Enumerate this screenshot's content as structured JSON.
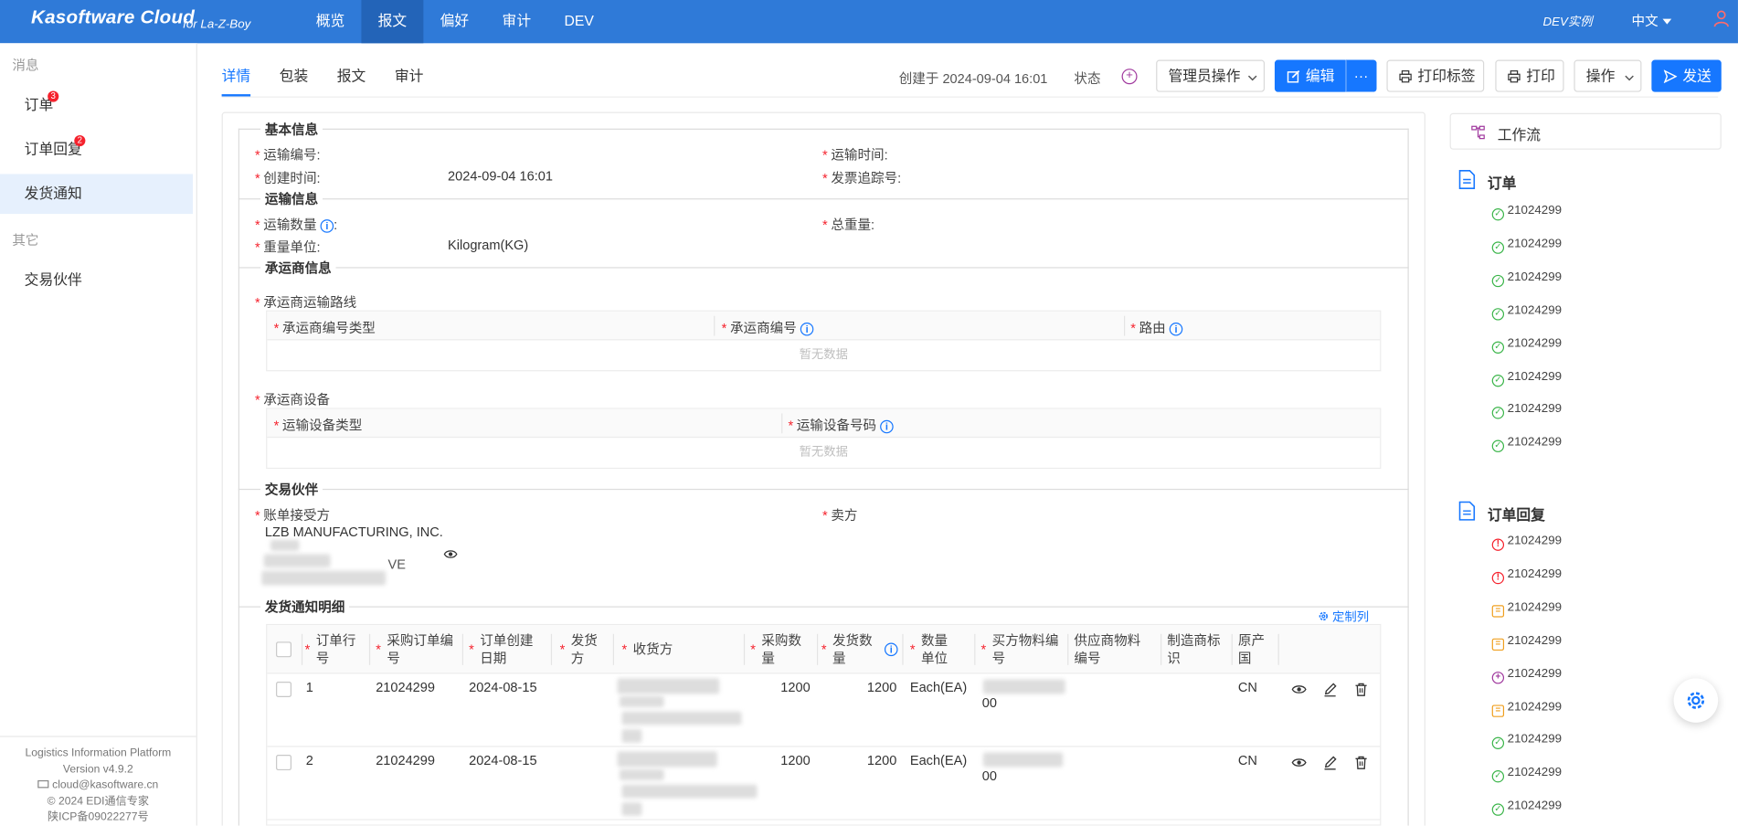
{
  "topbar": {
    "brand": "Kasoftware Cloud",
    "brand_sub": "for La-Z-Boy",
    "nav": [
      "概览",
      "报文",
      "偏好",
      "审计",
      "DEV"
    ],
    "active_nav": "报文",
    "instance": "DEV实例",
    "language": "中文"
  },
  "sidebar": {
    "group1": "消息",
    "items": [
      {
        "label": "订单",
        "badge": "3"
      },
      {
        "label": "订单回复",
        "badge": "2"
      },
      {
        "label": "发货通知",
        "badge": ""
      }
    ],
    "group2": "其它",
    "items2": [
      {
        "label": "交易伙伴"
      }
    ],
    "footer": {
      "platform": "Logistics Information Platform",
      "version": "Version v4.9.2",
      "email": "cloud@kasoftware.cn",
      "copyright": "© 2024 EDI通信专家",
      "icp": "陕ICP备09022277号"
    }
  },
  "tabs": [
    "详情",
    "包装",
    "报文",
    "审计"
  ],
  "header": {
    "created": "创建于 2024-09-04 16:01",
    "state_label": "状态",
    "admin_ops": "管理员操作",
    "edit": "编辑",
    "more": "···",
    "print_label": "打印标签",
    "print": "打印",
    "operations": "操作",
    "send": "发送"
  },
  "basic": {
    "title": "基本信息",
    "ship_no": "运输编号",
    "ship_time": "运输时间",
    "created_time": "创建时间",
    "created_time_value": "2024-09-04 16:01",
    "invoice_track": "发票追踪号"
  },
  "transport": {
    "title": "运输信息",
    "qty": "运输数量",
    "total_weight": "总重量",
    "weight_unit": "重量单位",
    "weight_unit_value": "Kilogram(KG)"
  },
  "carrier": {
    "title": "承运商信息",
    "route_title": "承运商运输路线",
    "route_cols": [
      "承运商编号类型",
      "承运商编号",
      "路由"
    ],
    "empty": "暂无数据",
    "equip_title": "承运商设备",
    "equip_cols": [
      "运输设备类型",
      "运输设备号码"
    ]
  },
  "partners": {
    "title": "交易伙伴",
    "bill_to": "账单接受方",
    "bill_to_name": "LZB MANUFACTURING, INC.",
    "bill_to_fragment": "VE",
    "seller": "卖方"
  },
  "detail": {
    "title": "发货通知明细",
    "customize": "定制列",
    "columns": [
      "订单行号",
      "采购订单编号",
      "订单创建日期",
      "发货方",
      "收货方",
      "采购数量",
      "发货数量",
      "数量单位",
      "买方物料编号",
      "供应商物料编号",
      "制造商标识",
      "原产国"
    ],
    "rows": [
      {
        "line": "1",
        "po": "21024299",
        "date": "2024-08-15",
        "po_qty": "1200",
        "ship_qty": "1200",
        "unit": "Each(EA)",
        "buyer_part_tail": "00",
        "origin": "CN"
      },
      {
        "line": "2",
        "po": "21024299",
        "date": "2024-08-15",
        "po_qty": "1200",
        "ship_qty": "1200",
        "unit": "Each(EA)",
        "buyer_part_tail": "00",
        "origin": "CN"
      }
    ]
  },
  "workflow": {
    "title": "工作流",
    "orders_title": "订单",
    "orders": [
      {
        "id": "21024299",
        "status": "ok"
      },
      {
        "id": "21024299",
        "status": "ok"
      },
      {
        "id": "21024299",
        "status": "ok"
      },
      {
        "id": "21024299",
        "status": "ok"
      },
      {
        "id": "21024299",
        "status": "ok"
      },
      {
        "id": "21024299",
        "status": "ok"
      },
      {
        "id": "21024299",
        "status": "ok"
      },
      {
        "id": "21024299",
        "status": "ok"
      }
    ],
    "replies_title": "订单回复",
    "replies": [
      {
        "id": "21024299",
        "status": "error"
      },
      {
        "id": "21024299",
        "status": "error"
      },
      {
        "id": "21024299",
        "status": "pending"
      },
      {
        "id": "21024299",
        "status": "pending"
      },
      {
        "id": "21024299",
        "status": "new"
      },
      {
        "id": "21024299",
        "status": "pending"
      },
      {
        "id": "21024299",
        "status": "ok"
      },
      {
        "id": "21024299",
        "status": "ok"
      },
      {
        "id": "21024299",
        "status": "ok"
      }
    ]
  },
  "colors": {
    "primary": "#1677ff",
    "topbar": "#2f7ad8",
    "required": "#f5222d",
    "ok": "#3bb54a",
    "error": "#f5222d",
    "pending": "#f0a020",
    "new": "#a0399e"
  }
}
